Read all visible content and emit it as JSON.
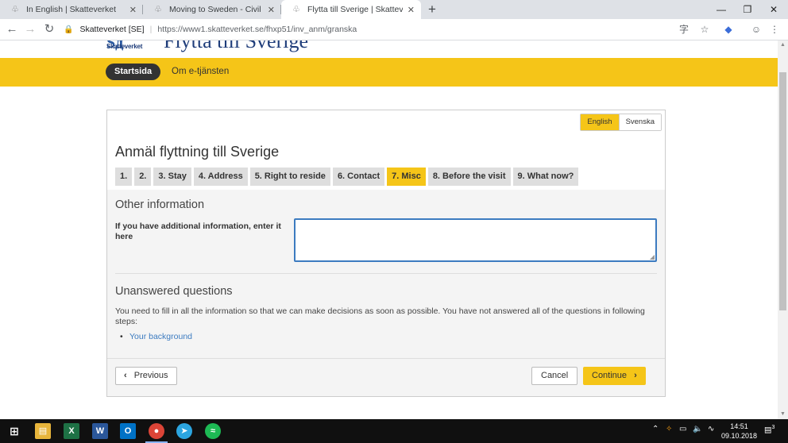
{
  "browser": {
    "tabs": [
      {
        "title": "In English | Skatteverket",
        "active": false
      },
      {
        "title": "Moving to Sweden - Civil registra",
        "active": false
      },
      {
        "title": "Flytta till Sverige | Skatteverket",
        "active": true
      }
    ],
    "new_tab": "+",
    "window_controls": {
      "minimize": "—",
      "restore": "❐",
      "close": "✕"
    },
    "address": {
      "site": "Skatteverket [SE]",
      "separator": "|",
      "url": "https://www1.skatteverket.se/fhxp51/inv_anm/granska"
    }
  },
  "site": {
    "logo_mark": "Sд",
    "logo_text": "Skatteverket",
    "title": "Flytta till Sverige",
    "nav": {
      "start": "Startsida",
      "about": "Om e-tjänsten"
    }
  },
  "form": {
    "languages": {
      "english": "English",
      "swedish": "Svenska",
      "selected": "English"
    },
    "title": "Anmäl flyttning till Sverige",
    "steps": [
      {
        "label": "1.",
        "current": false
      },
      {
        "label": "2.",
        "current": false
      },
      {
        "label": "3. Stay",
        "current": false
      },
      {
        "label": "4. Address",
        "current": false
      },
      {
        "label": "5. Right to reside",
        "current": false
      },
      {
        "label": "6. Contact",
        "current": false
      },
      {
        "label": "7. Misc",
        "current": true
      },
      {
        "label": "8. Before the visit",
        "current": false
      },
      {
        "label": "9. What now?",
        "current": false
      }
    ],
    "other_info": {
      "heading": "Other information",
      "label": "If you have additional information, enter it here",
      "value": ""
    },
    "unanswered": {
      "heading": "Unanswered questions",
      "text": "You need to fill in all the information so that we can make decisions as soon as possible. You have not answered all of the questions in following steps:",
      "links": [
        "Your background"
      ]
    },
    "buttons": {
      "previous": "Previous",
      "cancel": "Cancel",
      "continue": "Continue"
    }
  },
  "taskbar": {
    "time": "14:51",
    "date": "09.10.2018",
    "notification_count": "3"
  },
  "colors": {
    "accent_yellow": "#f5c518",
    "link_blue": "#3c7bc0",
    "dark": "#333333"
  }
}
